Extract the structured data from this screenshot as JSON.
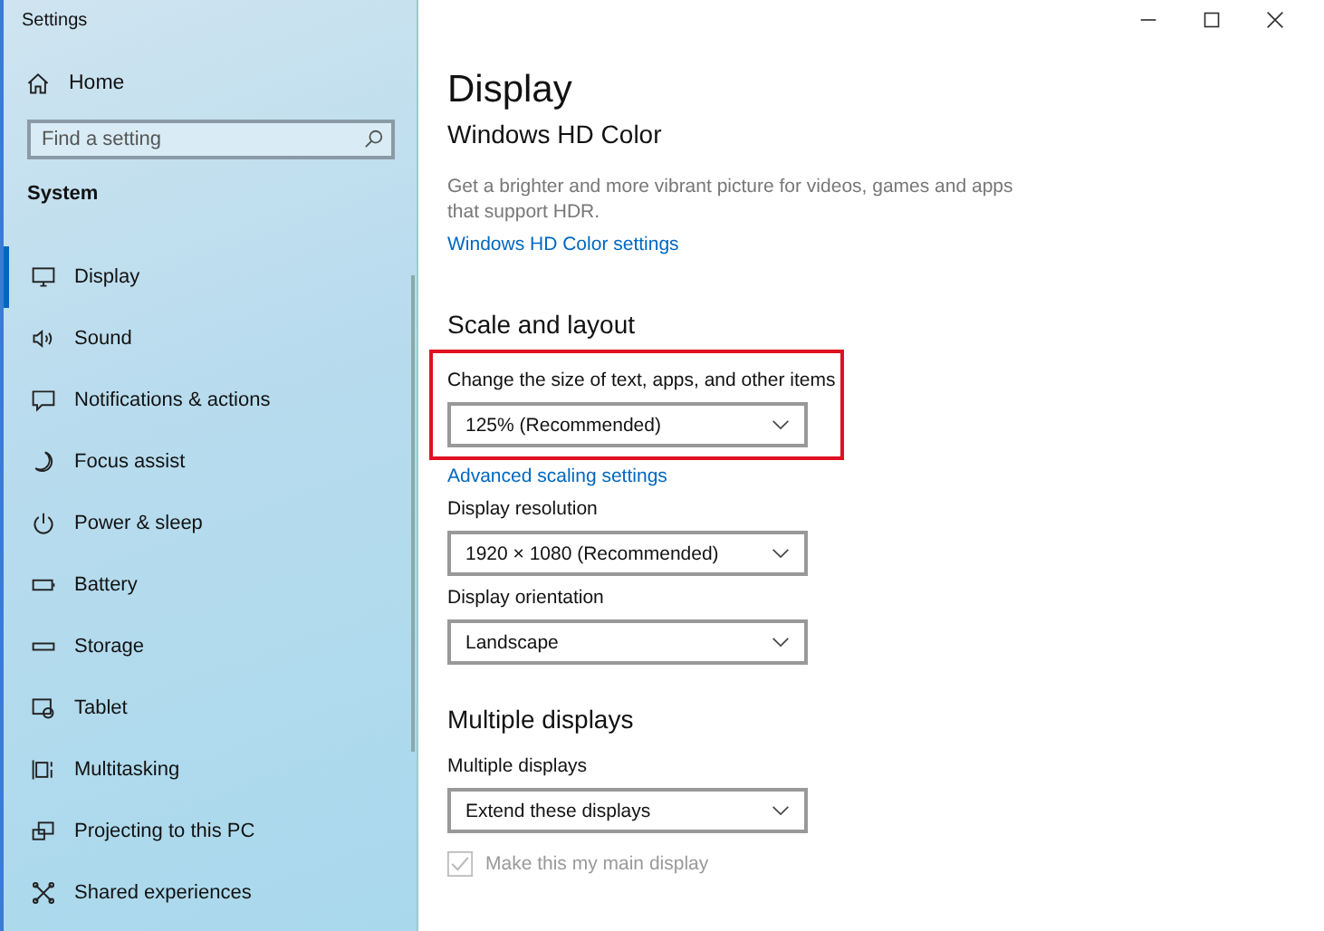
{
  "window": {
    "title": "Settings"
  },
  "sidebar": {
    "home": "Home",
    "search": {
      "placeholder": "Find a setting"
    },
    "section": "System",
    "items": [
      {
        "label": "Display",
        "selected": true
      },
      {
        "label": "Sound",
        "selected": false
      },
      {
        "label": "Notifications & actions",
        "selected": false
      },
      {
        "label": "Focus assist",
        "selected": false
      },
      {
        "label": "Power & sleep",
        "selected": false
      },
      {
        "label": "Battery",
        "selected": false
      },
      {
        "label": "Storage",
        "selected": false
      },
      {
        "label": "Tablet",
        "selected": false
      },
      {
        "label": "Multitasking",
        "selected": false
      },
      {
        "label": "Projecting to this PC",
        "selected": false
      },
      {
        "label": "Shared experiences",
        "selected": false
      }
    ]
  },
  "page": {
    "title": "Display",
    "hd_color": {
      "heading": "Windows HD Color",
      "description": "Get a brighter and more vibrant picture for videos, games and apps that support HDR.",
      "link": "Windows HD Color settings"
    },
    "scale": {
      "heading": "Scale and layout",
      "settings": [
        {
          "label": "Change the size of text, apps, and other items",
          "value": "125% (Recommended)",
          "highlighted": true,
          "link": "Advanced scaling settings"
        },
        {
          "label": "Display resolution",
          "value": "1920 × 1080 (Recommended)",
          "highlighted": false
        },
        {
          "label": "Display orientation",
          "value": "Landscape",
          "highlighted": false
        }
      ]
    },
    "multiple": {
      "heading": "Multiple displays",
      "settings": [
        {
          "label": "Multiple displays",
          "value": "Extend these displays"
        }
      ],
      "checkbox": {
        "label": "Make this my main display",
        "checked": true,
        "disabled": true
      }
    }
  }
}
